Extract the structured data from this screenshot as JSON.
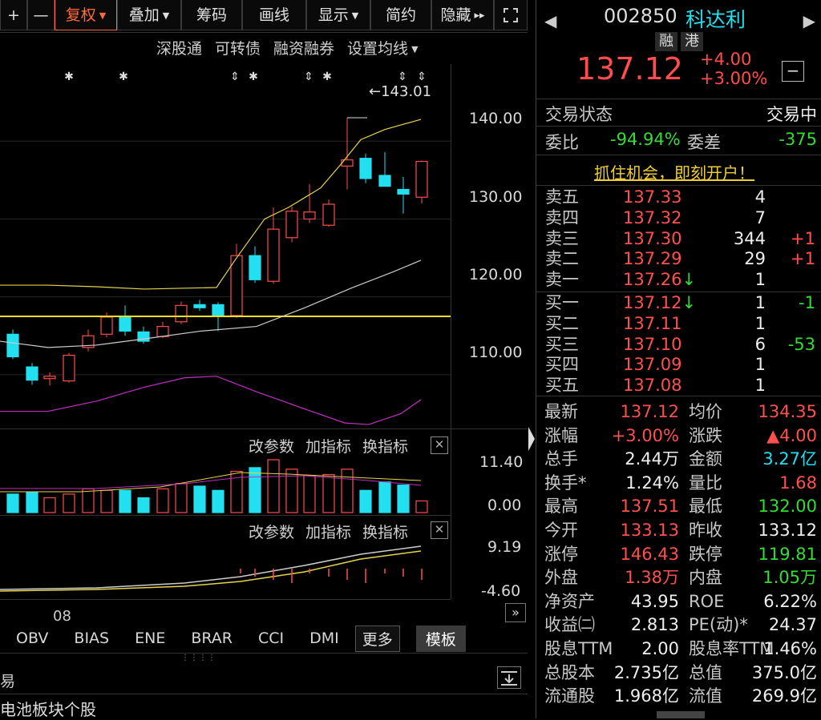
{
  "toolbar": {
    "items": [
      {
        "label": "+"
      },
      {
        "label": "—"
      },
      {
        "label": "复权",
        "caret": "▼"
      },
      {
        "label": "叠加",
        "caret": "▼"
      },
      {
        "label": "筹码"
      },
      {
        "label": "画线"
      },
      {
        "label": "显示",
        "caret": "▼"
      },
      {
        "label": "简约"
      },
      {
        "label": "隐藏",
        "caret": "▸▸"
      }
    ]
  },
  "subnav": [
    "深股通",
    "可转债",
    "融资融券",
    "设置均线"
  ],
  "main_chart": {
    "high_marker": "←143.01",
    "price_labels": [
      "140.00",
      "130.00",
      "120.00",
      "110.00"
    ]
  },
  "indicator_panel_1": {
    "buttons": [
      "改参数",
      "加指标",
      "换指标"
    ],
    "labels": [
      "11.40",
      "0.00"
    ]
  },
  "indicator_panel_2": {
    "buttons": [
      "改参数",
      "加指标",
      "换指标"
    ],
    "labels": [
      "9.19",
      "-4.60"
    ]
  },
  "x_axis": {
    "label": "08"
  },
  "bottom_tabs": [
    "OBV",
    "BIAS",
    "ENE",
    "BRAR",
    "CCI",
    "DMI"
  ],
  "bottom_buttons": {
    "more": "更多",
    "template": "模板"
  },
  "footer": {
    "left_char": "易",
    "news": "电池板块个股"
  },
  "quote": {
    "code": "002850",
    "name": "科达利",
    "tags": [
      "融",
      "港"
    ],
    "price": "137.12",
    "change": "+4.00",
    "change_pct": "+3.00%",
    "status_label": "交易状态",
    "status_value": "交易中",
    "ratio_label": "委比",
    "ratio_value": "-94.94%",
    "diff_label": "委差",
    "diff_value": "-375",
    "promo": "抓住机会，即刻开户！"
  },
  "order_book": {
    "asks": [
      {
        "label": "卖五",
        "price": "137.33",
        "vol": "4",
        "chg": ""
      },
      {
        "label": "卖四",
        "price": "137.32",
        "vol": "7",
        "chg": ""
      },
      {
        "label": "卖三",
        "price": "137.30",
        "vol": "344",
        "chg": "+1"
      },
      {
        "label": "卖二",
        "price": "137.29",
        "vol": "29",
        "chg": "+1"
      },
      {
        "label": "卖一",
        "price": "137.26",
        "arrow": "↓",
        "vol": "1",
        "chg": ""
      }
    ],
    "bids": [
      {
        "label": "买一",
        "price": "137.12",
        "arrow": "↓",
        "vol": "1",
        "chg": "-1"
      },
      {
        "label": "买二",
        "price": "137.11",
        "vol": "1",
        "chg": ""
      },
      {
        "label": "买三",
        "price": "137.10",
        "vol": "6",
        "chg": "-53"
      },
      {
        "label": "买四",
        "price": "137.09",
        "vol": "1",
        "chg": ""
      },
      {
        "label": "买五",
        "price": "137.08",
        "vol": "1",
        "chg": ""
      }
    ]
  },
  "stats": [
    {
      "l1": "最新",
      "v1": "137.12",
      "c1": "red",
      "l2": "均价",
      "v2": "134.35",
      "c2": "red"
    },
    {
      "l1": "涨幅",
      "v1": "+3.00%",
      "c1": "red",
      "l2": "涨跌",
      "v2": "▲4.00",
      "c2": "red"
    },
    {
      "l1": "总手",
      "v1": "2.44万",
      "c1": "white",
      "l2": "金额",
      "v2": "3.27亿",
      "c2": "cyan"
    },
    {
      "l1": "换手*",
      "v1": "1.24%",
      "c1": "white",
      "l2": "量比",
      "v2": "1.68",
      "c2": "red"
    },
    {
      "l1": "最高",
      "v1": "137.51",
      "c1": "red",
      "l2": "最低",
      "v2": "132.00",
      "c2": "green"
    },
    {
      "l1": "今开",
      "v1": "133.13",
      "c1": "red",
      "l2": "昨收",
      "v2": "133.12",
      "c2": "white"
    },
    {
      "l1": "涨停",
      "v1": "146.43",
      "c1": "red",
      "l2": "跌停",
      "v2": "119.81",
      "c2": "green"
    },
    {
      "l1": "外盘",
      "v1": "1.38万",
      "c1": "red",
      "l2": "内盘",
      "v2": "1.05万",
      "c2": "green"
    },
    {
      "l1": "净资产",
      "v1": "43.95",
      "c1": "white",
      "l2": "ROE",
      "v2": "6.22%",
      "c2": "white"
    },
    {
      "l1": "收益㈡",
      "v1": "2.813",
      "c1": "white",
      "l2": "PE(动)*",
      "v2": "24.37",
      "c2": "white"
    },
    {
      "l1": "股息TTM",
      "v1": "2.00",
      "c1": "white",
      "l2": "股息率TTM",
      "v2": "1.46%",
      "c2": "white"
    },
    {
      "l1": "总股本",
      "v1": "2.735亿",
      "c1": "white",
      "l2": "总值",
      "v2": "375.0亿",
      "c2": "white"
    },
    {
      "l1": "流通股",
      "v1": "1.968亿",
      "c1": "white",
      "l2": "流值",
      "v2": "269.9亿",
      "c2": "white"
    }
  ],
  "colors": {
    "up": "#ff4d4d",
    "down": "#22e0f0",
    "ma_yellow": "#e6d44a",
    "ma_white": "#cccccc",
    "ma_purple": "#c030c0"
  }
}
